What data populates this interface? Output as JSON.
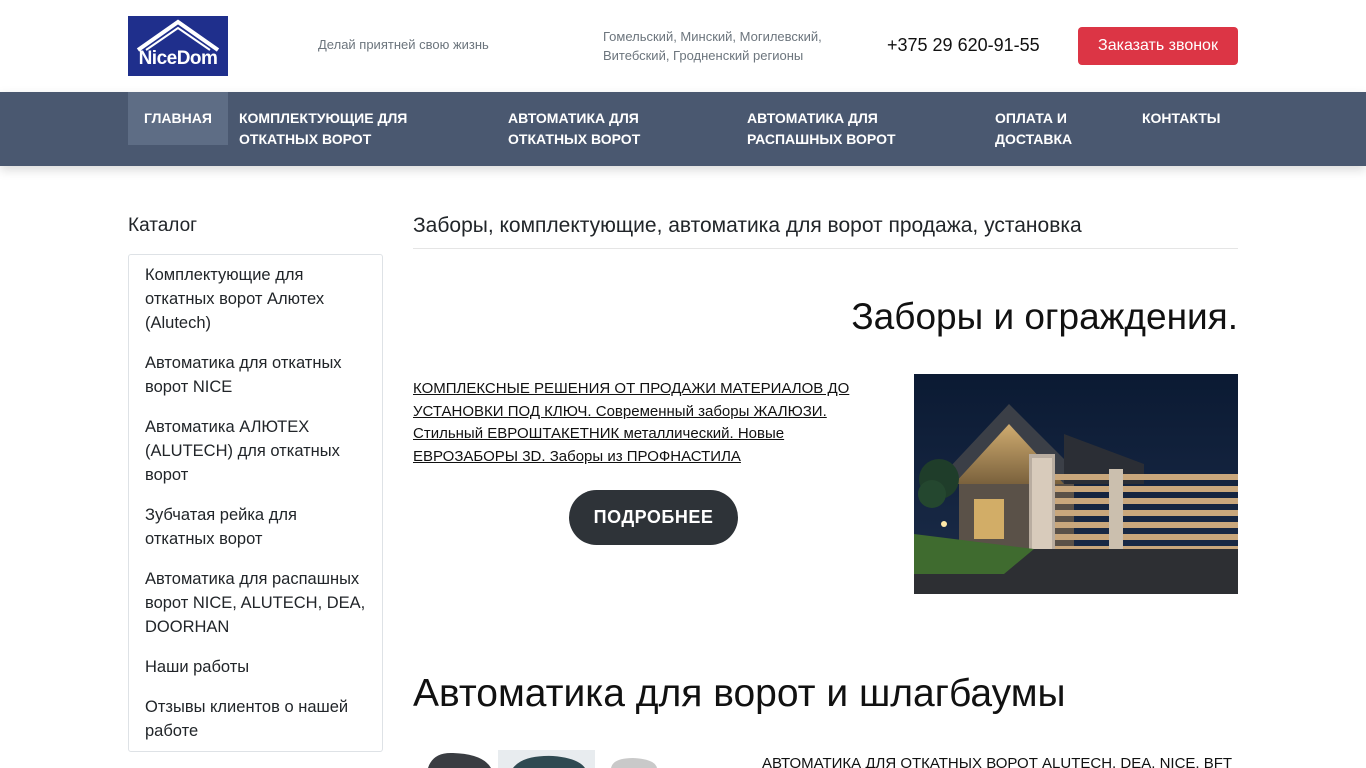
{
  "header": {
    "logo_text": "NiceDom",
    "slogan": "Делай приятней свою жизнь",
    "regions": "Гомельский, Минский, Могилевский, Витебский, Гродненский регионы",
    "phone": "+375 29 620-91-55",
    "callback_label": "Заказать звонок"
  },
  "nav": {
    "items": [
      {
        "label": "ГЛАВНАЯ",
        "active": true
      },
      {
        "label": "КОМПЛЕКТУЮЩИЕ ДЛЯ ОТКАТНЫХ ВОРОТ"
      },
      {
        "label": "АВТОМАТИКА ДЛЯ ОТКАТНЫХ ВОРОТ"
      },
      {
        "label": "АВТОМАТИКА ДЛЯ РАСПАШНЫХ ВОРОТ"
      },
      {
        "label": "ОПЛАТА И ДОСТАВКА"
      },
      {
        "label": "КОНТАКТЫ"
      }
    ]
  },
  "sidebar": {
    "title": "Каталог",
    "items": [
      {
        "label": "Комплектующие для откатных ворот Алютех (Alutech)"
      },
      {
        "label": "Автоматика для откатных ворот NICE"
      },
      {
        "label": "Автоматика АЛЮТЕХ (ALUTECH) для откатных ворот"
      },
      {
        "label": "Зубчатая рейка для откатных ворот"
      },
      {
        "label": "Автоматика для распашных ворот NICE, ALUTECH, DEA, DOORHAN"
      },
      {
        "label": "Наши работы"
      },
      {
        "label": "Отзывы клиентов о нашей работе"
      }
    ]
  },
  "main": {
    "title": "Заборы, комплектующие, автоматика для ворот продажа, установка",
    "section1": {
      "title": "Заборы и ограждения.",
      "link_text": "КОМПЛЕКСНЫЕ РЕШЕНИЯ ОТ ПРОДАЖИ МАТЕРИАЛОВ ДО УСТАНОВКИ ПОД КЛЮЧ. Современный заборы ЖАЛЮЗИ. Стильный ЕВРОШТАКЕТНИК металлический. Новые ЕВРОЗАБОРЫ 3D. Заборы из ПРОФНАСТИЛА",
      "button_label": "ПОДРОБНЕЕ"
    },
    "section2": {
      "title": "Автоматика для ворот и шлагбаумы",
      "link_text": "АВТОМАТИКА ДЛЯ ОТКАТНЫХ ВОРОТ ALUTECH, DEA, NICE, BFT"
    }
  },
  "colors": {
    "nav_bg": "#4a5870",
    "nav_active": "#5e6d85",
    "callback_bg": "#dc3545",
    "button_dark": "#2e3338",
    "logo_bg": "#1f2f8c"
  }
}
